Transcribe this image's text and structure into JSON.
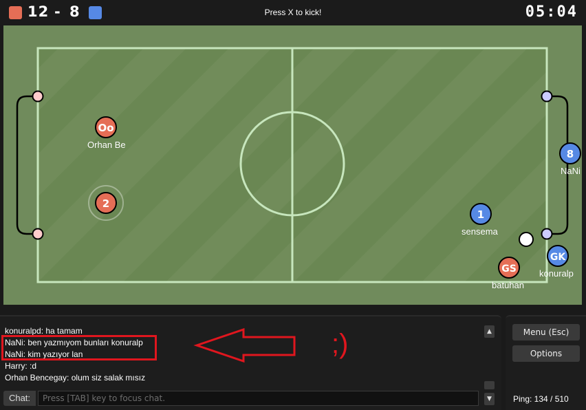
{
  "topbar": {
    "red_score": "12",
    "separator": "-",
    "blue_score": "8",
    "hint": "Press X to kick!",
    "timer": "05:04",
    "red_color": "#e56e56",
    "blue_color": "#5689e5"
  },
  "field": {
    "grass_colors": [
      "#718c5a",
      "#6a8753"
    ],
    "line_color": "#c7e6bd",
    "players": [
      {
        "name": "Orhan Be",
        "avatar": "Oo",
        "team": "red"
      },
      {
        "name": "",
        "avatar": "2",
        "team": "red"
      },
      {
        "name": "sensema",
        "avatar": "1",
        "team": "blue"
      },
      {
        "name": "NaNi",
        "avatar": "8",
        "team": "blue"
      },
      {
        "name": "konuralp",
        "avatar": "GK",
        "team": "blue"
      },
      {
        "name": "batuhan",
        "avatar": "GS",
        "team": "red"
      }
    ]
  },
  "chat": {
    "lines": [
      "konuralpd: ha tamam",
      "NaNi: ben yazmıyom bunları konuralp",
      "NaNi: kim yazıyor lan",
      "Harry: :d",
      "Orhan Bencegay: olum siz salak mısız"
    ],
    "label": "Chat:",
    "placeholder": "Press [TAB] key to focus chat.",
    "scroll_up": "▲",
    "scroll_down": "▼"
  },
  "annotation": {
    "smiley": ";)",
    "color": "#e0161e"
  },
  "side": {
    "menu_label": "Menu (Esc)",
    "options_label": "Options",
    "ping": "Ping: 134 / 510"
  }
}
